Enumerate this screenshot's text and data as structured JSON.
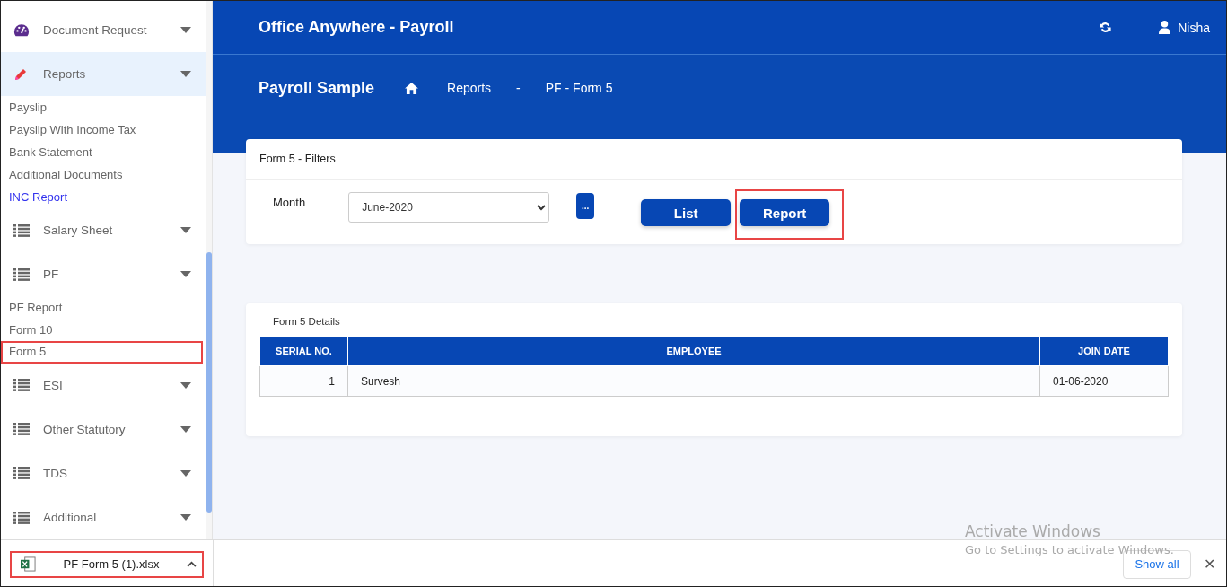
{
  "sidebar": {
    "items": [
      {
        "label": "Document Request",
        "selected": false
      },
      {
        "label": "Reports",
        "selected": true,
        "children": [
          {
            "label": "Payslip",
            "selected": false,
            "highlighted": false
          },
          {
            "label": "Payslip With Income Tax",
            "selected": false,
            "highlighted": false
          },
          {
            "label": "Bank Statement",
            "selected": false,
            "highlighted": false
          },
          {
            "label": "Additional Documents",
            "selected": false,
            "highlighted": false
          },
          {
            "label": "INC Report",
            "selected": true,
            "highlighted": false
          }
        ]
      },
      {
        "label": "Salary Sheet",
        "selected": false
      },
      {
        "label": "PF",
        "selected": false,
        "children": [
          {
            "label": "PF Report",
            "selected": false,
            "highlighted": false
          },
          {
            "label": "Form 10",
            "selected": false,
            "highlighted": false
          },
          {
            "label": "Form 5",
            "selected": false,
            "highlighted": true
          }
        ]
      },
      {
        "label": "ESI",
        "selected": false
      },
      {
        "label": "Other Statutory",
        "selected": false
      },
      {
        "label": "TDS",
        "selected": false
      },
      {
        "label": "Additional",
        "selected": false
      }
    ]
  },
  "header": {
    "title": "Office Anywhere - Payroll",
    "user": "Nisha"
  },
  "breadcrumb": {
    "company": "Payroll Sample",
    "items": [
      "Reports",
      "-",
      "PF - Form 5"
    ]
  },
  "filters": {
    "title": "Form 5 - Filters",
    "month_label": "Month",
    "month_value": "June-2020",
    "more_button": "...",
    "buttons": [
      {
        "label": "List",
        "highlighted": false
      },
      {
        "label": "Report",
        "highlighted": true
      }
    ]
  },
  "details": {
    "title": "Form 5 Details",
    "table": {
      "columns": [
        "SERIAL NO.",
        "EMPLOYEE",
        "JOIN DATE"
      ],
      "rows": [
        [
          "1",
          "Survesh",
          "01-06-2020"
        ]
      ]
    }
  },
  "download_bar": {
    "file": "PF Form 5 (1).xlsx",
    "highlighted": true,
    "show_all": "Show all",
    "close": "✕"
  },
  "activation_notice": {
    "title": "Activate Windows",
    "message": "Go to Settings to activate Windows."
  }
}
